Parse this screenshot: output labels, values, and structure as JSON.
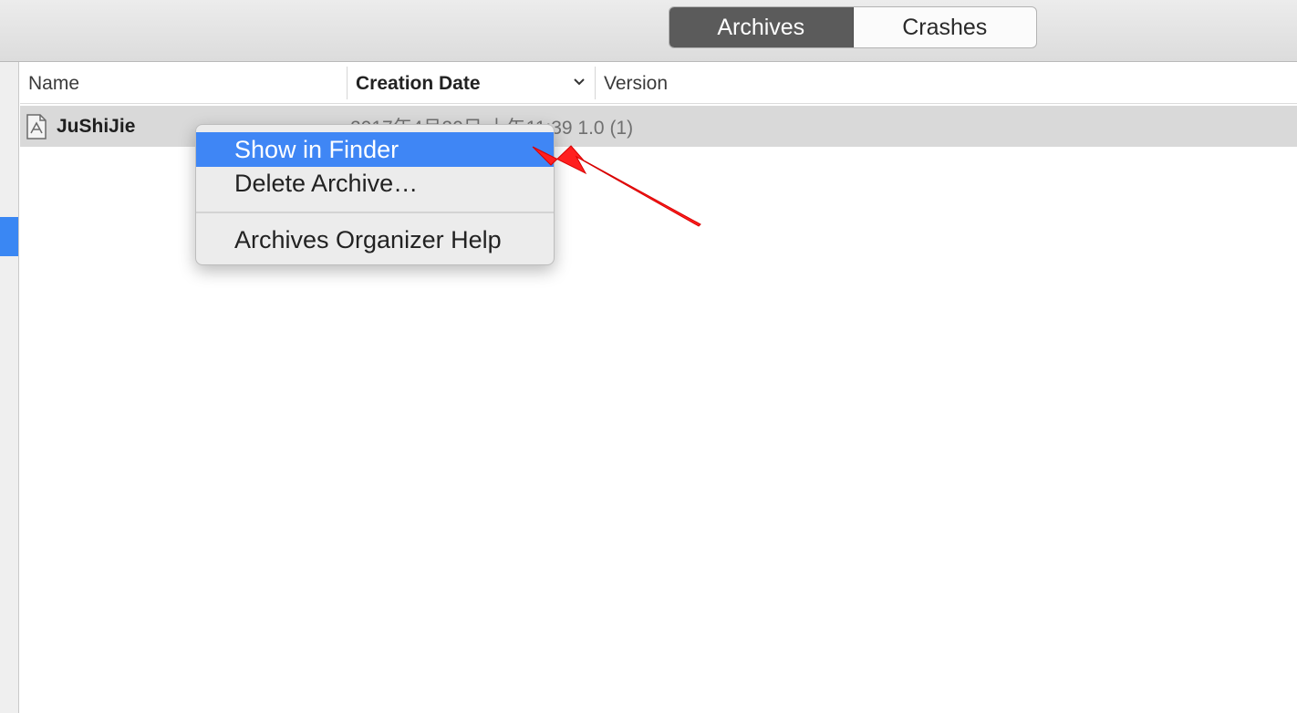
{
  "toolbar": {
    "segments": [
      {
        "label": "Archives",
        "active": true
      },
      {
        "label": "Crashes",
        "active": false
      }
    ]
  },
  "table": {
    "columns": [
      "Name",
      "Creation Date",
      "Version"
    ],
    "rows": [
      {
        "icon": "archive-icon",
        "name": "JuShiJie",
        "date_version": "2017年4月20日 上午11:39 1.0 (1)"
      }
    ]
  },
  "context_menu": {
    "items": [
      {
        "label": "Show in Finder",
        "highlighted": true
      },
      {
        "label": "Delete Archive…",
        "highlighted": false
      },
      {
        "label": "Archives Organizer Help",
        "highlighted": false
      }
    ]
  },
  "colors": {
    "selection": "#3f86f5",
    "arrow": "#ff1f1f"
  }
}
